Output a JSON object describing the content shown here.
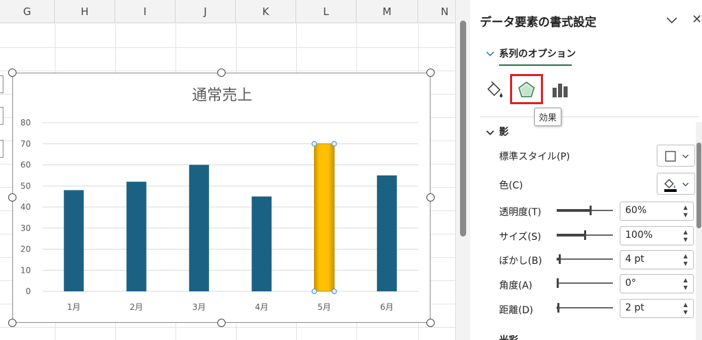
{
  "sheet": {
    "columns": [
      "G",
      "H",
      "I",
      "J",
      "K",
      "L",
      "M",
      "N"
    ]
  },
  "chart_data": {
    "type": "bar",
    "title": "通常売上",
    "categories": [
      "1月",
      "2月",
      "3月",
      "4月",
      "5月",
      "6月"
    ],
    "series": [
      {
        "values": [
          48,
          52,
          60,
          45,
          70,
          55
        ]
      }
    ],
    "ylim": [
      0,
      80
    ],
    "yticks": [
      0,
      10,
      20,
      30,
      40,
      50,
      60,
      70,
      80
    ],
    "xlabel": "",
    "ylabel": "",
    "grid": true,
    "selected_category_index": 4,
    "colors": {
      "bar": "#1b6184",
      "selected_bar": "#ffc000",
      "selected_bar_edge": "#c79400",
      "grid": "#d9d9d9",
      "text": "#595959"
    }
  },
  "pane": {
    "title": "データ要素の書式設定",
    "collapse_icon": "chevron-down-icon",
    "close_label": "✕",
    "series_options_label": "系列のオプション",
    "icons": [
      "paint-bucket-icon",
      "effects-pentagon-icon",
      "bar-chart-icon"
    ],
    "tooltip": "効果",
    "shadow_section_label": "影",
    "glow_section_label": "光彩",
    "properties": {
      "preset_style": {
        "label": "標準スタイル(P)"
      },
      "color": {
        "label": "色(C)"
      },
      "transparency": {
        "label": "透明度(T)",
        "value": "60%",
        "level": 0.6
      },
      "size": {
        "label": "サイズ(S)",
        "value": "100%",
        "level": 0.5
      },
      "blur": {
        "label": "ぼかし(B)",
        "value": "4 pt",
        "level": 0.04
      },
      "angle": {
        "label": "角度(A)",
        "value": "0°",
        "level": 0
      },
      "distance": {
        "label": "距離(D)",
        "value": "2 pt",
        "level": 0.01
      }
    },
    "accent_color": "#217346",
    "highlight_color": "#e02020"
  }
}
